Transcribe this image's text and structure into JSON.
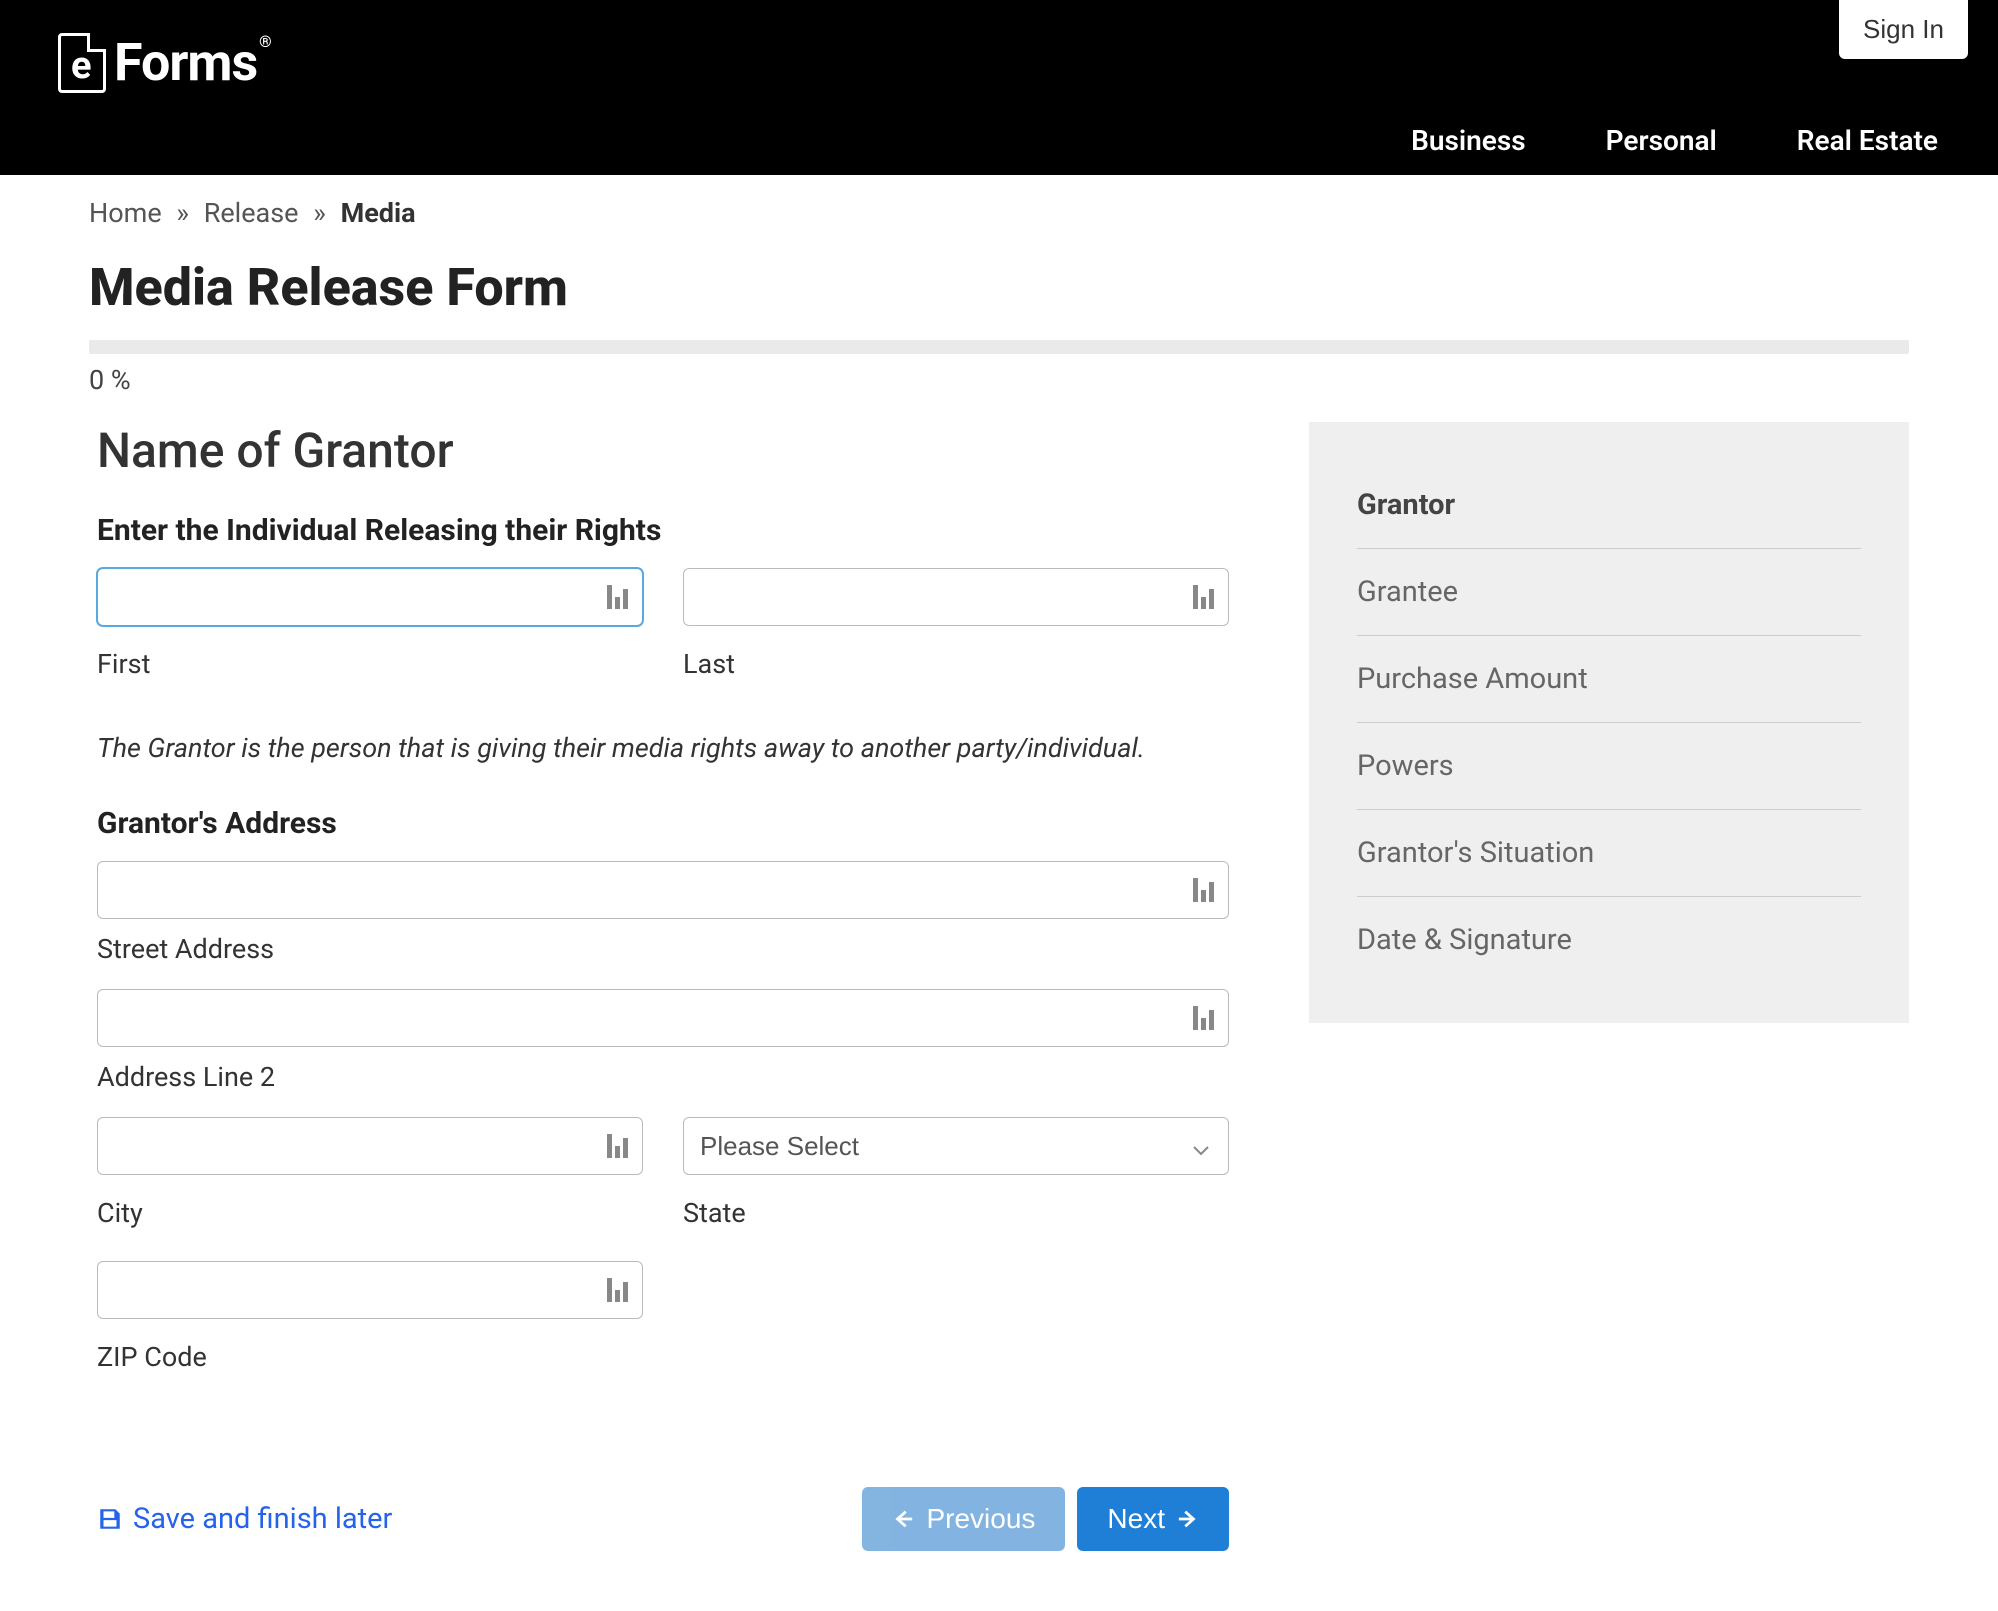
{
  "header": {
    "signin": "Sign In",
    "logo_text": "Forms",
    "nav": [
      "Business",
      "Personal",
      "Real Estate"
    ]
  },
  "breadcrumb": {
    "items": [
      "Home",
      "Release"
    ],
    "current": "Media"
  },
  "page": {
    "title": "Media Release Form",
    "progress": "0 %"
  },
  "form": {
    "section_title": "Name of Grantor",
    "individual_heading": "Enter the Individual Releasing their Rights",
    "first_label": "First",
    "last_label": "Last",
    "note": "The Grantor is the person that is giving their media rights away to another party/individual.",
    "address_heading": "Grantor's Address",
    "street_label": "Street Address",
    "line2_label": "Address Line 2",
    "city_label": "City",
    "state_label": "State",
    "state_placeholder": "Please Select",
    "zip_label": "ZIP Code"
  },
  "sidebar": {
    "items": [
      {
        "label": "Grantor",
        "active": true
      },
      {
        "label": "Grantee",
        "active": false
      },
      {
        "label": "Purchase Amount",
        "active": false
      },
      {
        "label": "Powers",
        "active": false
      },
      {
        "label": "Grantor's Situation",
        "active": false
      },
      {
        "label": "Date & Signature",
        "active": false
      }
    ]
  },
  "actions": {
    "save": "Save and finish later",
    "previous": "Previous",
    "next": "Next"
  }
}
